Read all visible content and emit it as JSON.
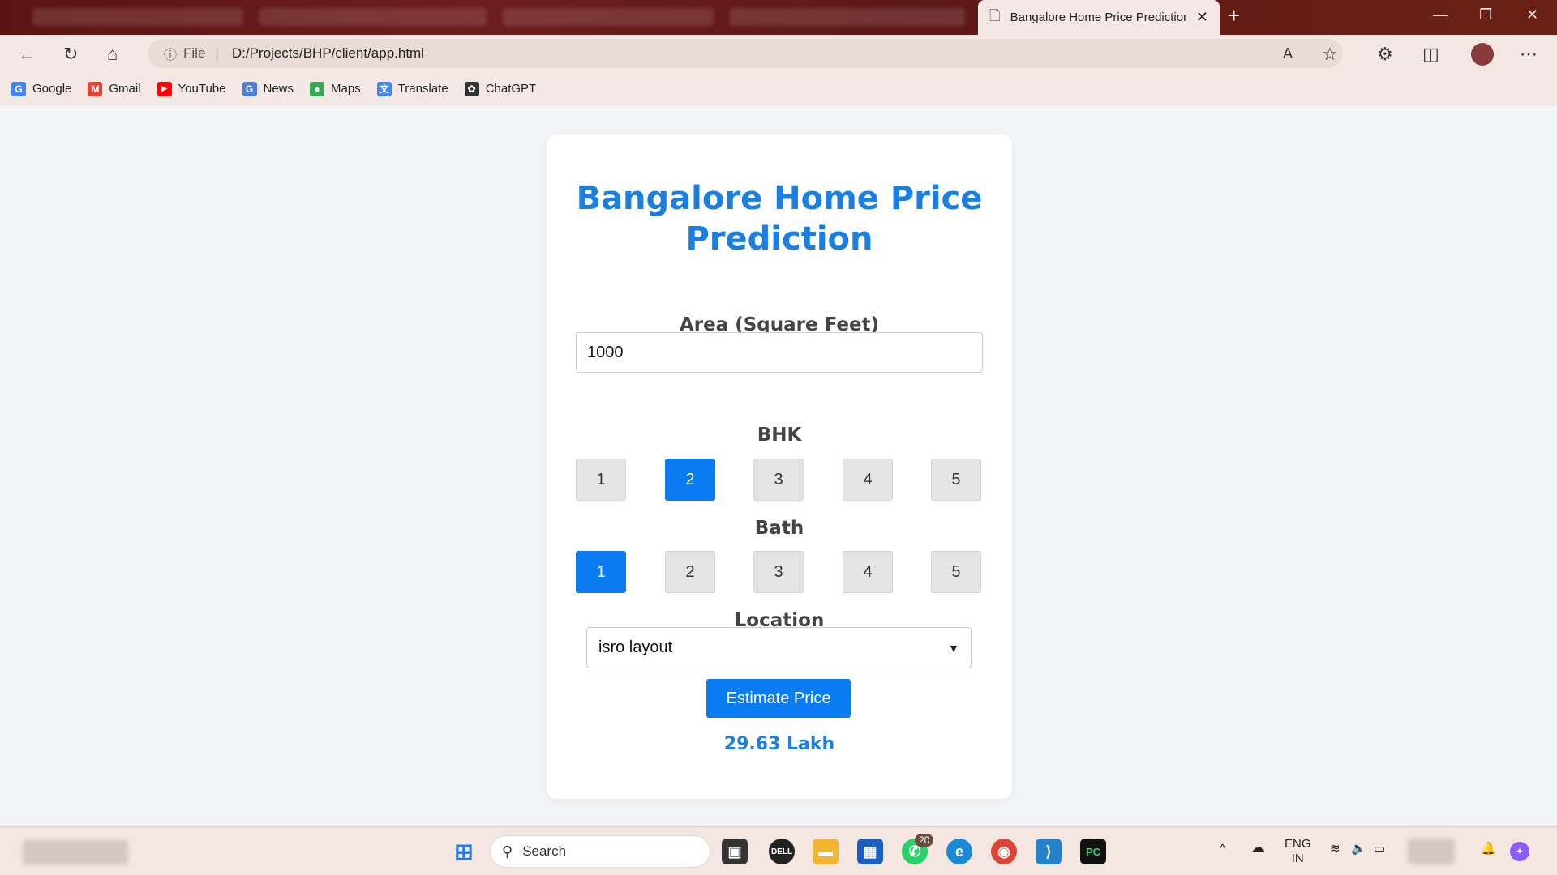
{
  "browser": {
    "active_tab_title": "Bangalore Home Price Prediction",
    "address": {
      "scheme_label": "File",
      "url": "D:/Projects/BHP/client/app.html"
    },
    "bookmarks": [
      {
        "label": "Google",
        "icon": "google-icon",
        "color": "#4285f4",
        "glyph": "G"
      },
      {
        "label": "Gmail",
        "icon": "gmail-icon",
        "color": "#ea4335",
        "glyph": "M"
      },
      {
        "label": "YouTube",
        "icon": "youtube-icon",
        "color": "#ff0000",
        "glyph": "▶"
      },
      {
        "label": "News",
        "icon": "news-icon",
        "color": "#4a7fe0",
        "glyph": "G"
      },
      {
        "label": "Maps",
        "icon": "maps-icon",
        "color": "#34a853",
        "glyph": "●"
      },
      {
        "label": "Translate",
        "icon": "translate-icon",
        "color": "#4285f4",
        "glyph": "文"
      },
      {
        "label": "ChatGPT",
        "icon": "chatgpt-icon",
        "color": "#333333",
        "glyph": "✿"
      }
    ]
  },
  "app": {
    "title": "Bangalore Home Price Prediction",
    "area_label": "Area (Square Feet)",
    "area_value": "1000",
    "bhk_label": "BHK",
    "bhk_options": [
      "1",
      "2",
      "3",
      "4",
      "5"
    ],
    "bhk_selected": "2",
    "bath_label": "Bath",
    "bath_options": [
      "1",
      "2",
      "3",
      "4",
      "5"
    ],
    "bath_selected": "1",
    "location_label": "Location",
    "location_value": "isro layout",
    "estimate_button": "Estimate Price",
    "result": "29.63 Lakh",
    "accent_color": "#0b7bf2"
  },
  "taskbar": {
    "search_placeholder": "Search",
    "whatsapp_badge": "20",
    "lang_line1": "ENG",
    "lang_line2": "IN"
  }
}
